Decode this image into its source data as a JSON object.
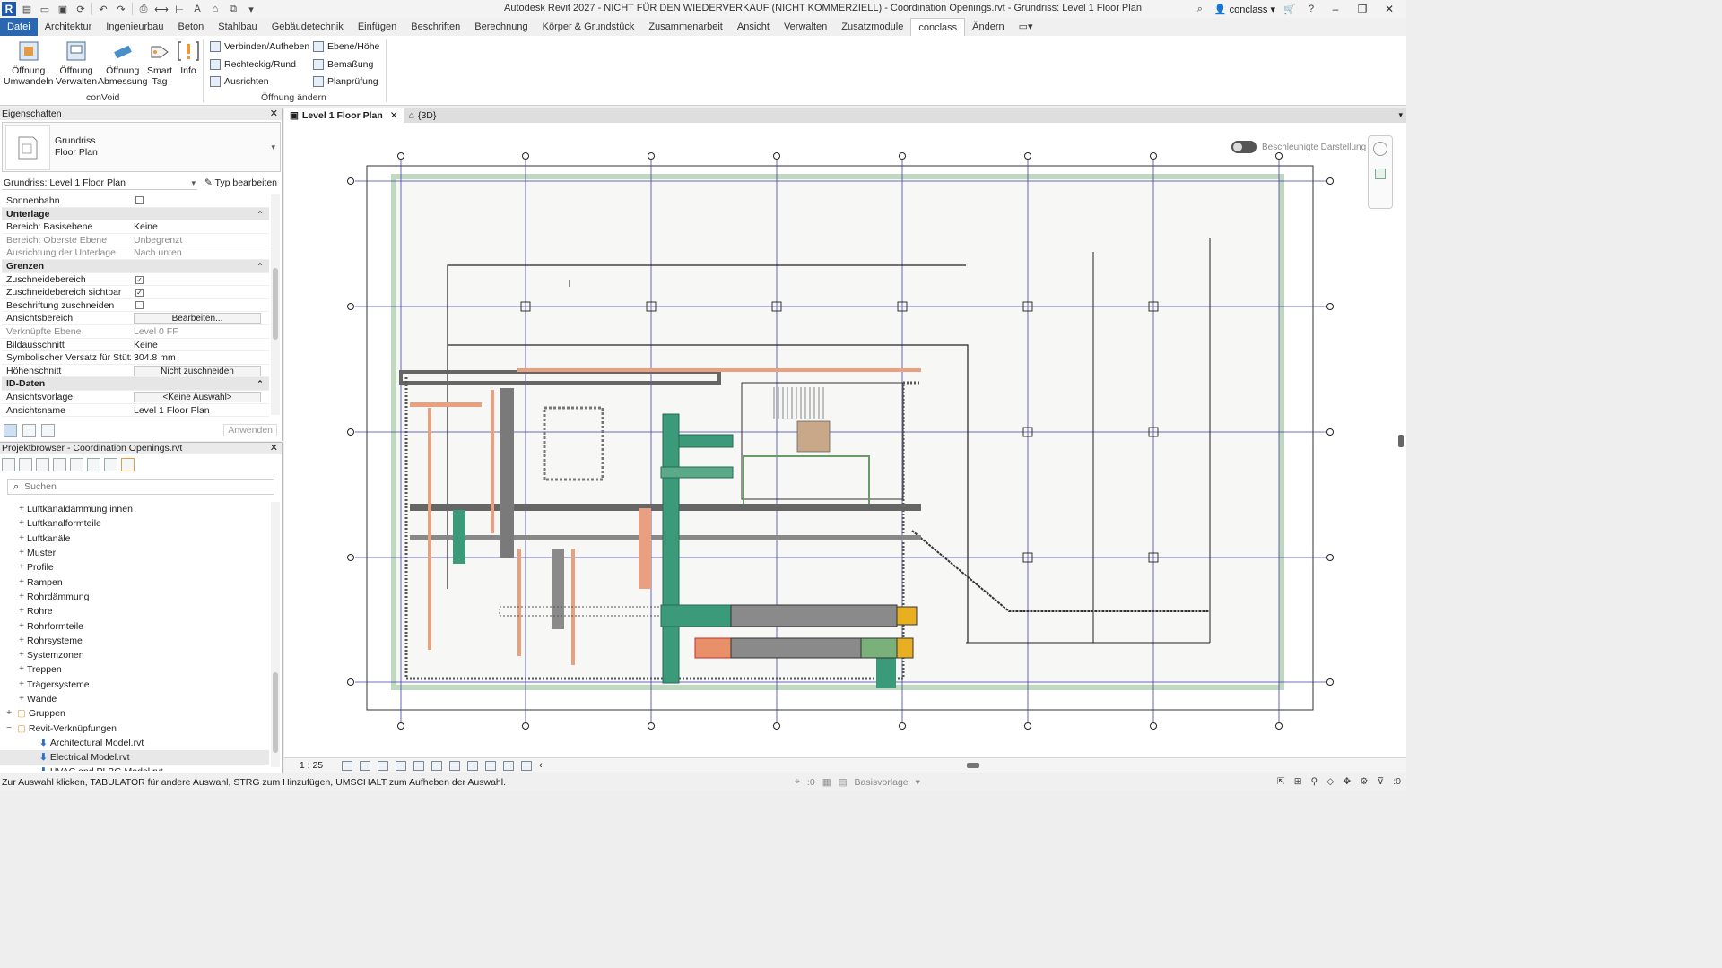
{
  "app": {
    "title": "Autodesk Revit 2027 - NICHT FÜR DEN WIEDERVERKAUF (NICHT KOMMERZIELL) - Coordination Openings.rvt - Grundriss: Level 1 Floor Plan",
    "user": "conclass"
  },
  "ribbon": {
    "tabs": [
      "Datei",
      "Architektur",
      "Ingenieurbau",
      "Beton",
      "Stahlbau",
      "Gebäudetechnik",
      "Einfügen",
      "Beschriften",
      "Berechnung",
      "Körper & Grundstück",
      "Zusammenarbeit",
      "Ansicht",
      "Verwalten",
      "Zusatzmodule",
      "conclass",
      "Ändern"
    ],
    "active_tab": "conclass",
    "convoid": {
      "label": "conVoid",
      "btn1": "Öffnung\nUmwandeln",
      "btn1a": "Öffnung",
      "btn1b": "Umwandeln",
      "btn2a": "Öffnung",
      "btn2b": "Verwalten",
      "btn3a": "Öffnung",
      "btn3b": "Abmessung",
      "btn4a": "Smart",
      "btn4b": "Tag",
      "btn5": "Info"
    },
    "oeffnung_aendern": {
      "label": "Öffnung ändern",
      "items": [
        "Verbinden/Aufheben",
        "Rechteckig/Rund",
        "Ausrichten",
        "Ebene/Höhe",
        "Bemaßung",
        "Planprüfung"
      ]
    }
  },
  "properties": {
    "title": "Eigenschaften",
    "type_line1": "Grundriss",
    "type_line2": "Floor Plan",
    "instance_selector": "Grundriss: Level 1 Floor Plan",
    "edit_type": "Typ bearbeiten",
    "apply": "Anwenden",
    "rows": [
      {
        "k": "Sonnenbahn",
        "v": "",
        "kind": "check",
        "checked": false
      },
      {
        "k": "Unterlage",
        "kind": "section"
      },
      {
        "k": "Bereich: Basisebene",
        "v": "Keine"
      },
      {
        "k": "Bereich: Oberste Ebene",
        "v": "Unbegrenzt",
        "ro": true
      },
      {
        "k": "Ausrichtung der Unterlage",
        "v": "Nach unten",
        "ro": true
      },
      {
        "k": "Grenzen",
        "kind": "section"
      },
      {
        "k": "Zuschneidebereich",
        "v": "",
        "kind": "check",
        "checked": true
      },
      {
        "k": "Zuschneidebereich sichtbar",
        "v": "",
        "kind": "check",
        "checked": true
      },
      {
        "k": "Beschriftung zuschneiden",
        "v": "",
        "kind": "check",
        "checked": false
      },
      {
        "k": "Ansichtsbereich",
        "v": "Bearbeiten...",
        "kind": "button"
      },
      {
        "k": "Verknüpfte Ebene",
        "v": "Level 0 FF",
        "ro": true
      },
      {
        "k": "Bildausschnitt",
        "v": "Keine"
      },
      {
        "k": "Symbolischer Versatz für Stütze",
        "v": "304.8 mm"
      },
      {
        "k": "Höhenschnitt",
        "v": "Nicht zuschneiden",
        "kind": "button"
      },
      {
        "k": "ID-Daten",
        "kind": "section"
      },
      {
        "k": "Ansichtsvorlage",
        "v": "<Keine Auswahl>",
        "kind": "button"
      },
      {
        "k": "Ansichtsname",
        "v": "Level 1 Floor Plan"
      }
    ]
  },
  "browser": {
    "title": "Projektbrowser - Coordination Openings.rvt",
    "search_placeholder": "Suchen",
    "items": [
      {
        "label": "Luftkanaldämmung innen",
        "indent": 1,
        "exp": "+"
      },
      {
        "label": "Luftkanalformteile",
        "indent": 1,
        "exp": "+"
      },
      {
        "label": "Luftkanäle",
        "indent": 1,
        "exp": "+"
      },
      {
        "label": "Muster",
        "indent": 1,
        "exp": "+"
      },
      {
        "label": "Profile",
        "indent": 1,
        "exp": "+"
      },
      {
        "label": "Rampen",
        "indent": 1,
        "exp": "+"
      },
      {
        "label": "Rohrdämmung",
        "indent": 1,
        "exp": "+"
      },
      {
        "label": "Rohre",
        "indent": 1,
        "exp": "+"
      },
      {
        "label": "Rohrformteile",
        "indent": 1,
        "exp": "+"
      },
      {
        "label": "Rohrsysteme",
        "indent": 1,
        "exp": "+"
      },
      {
        "label": "Systemzonen",
        "indent": 1,
        "exp": "+"
      },
      {
        "label": "Treppen",
        "indent": 1,
        "exp": "+"
      },
      {
        "label": "Trägersysteme",
        "indent": 1,
        "exp": "+"
      },
      {
        "label": "Wände",
        "indent": 1,
        "exp": "+"
      },
      {
        "label": "Gruppen",
        "indent": 0,
        "exp": "+"
      },
      {
        "label": "Revit-Verknüpfungen",
        "indent": 0,
        "exp": "−"
      },
      {
        "label": "Architectural Model.rvt",
        "indent": 2,
        "exp": "",
        "link": true
      },
      {
        "label": "Electrical Model.rvt",
        "indent": 2,
        "exp": "",
        "link": true,
        "selected": true
      },
      {
        "label": "HVAC and PLBG Model.rvt",
        "indent": 2,
        "exp": "",
        "link": true
      }
    ]
  },
  "view_tabs": [
    {
      "label": "Level 1 Floor Plan",
      "active": true
    },
    {
      "label": "{3D}",
      "active": false
    }
  ],
  "canvas": {
    "accel_label": "Beschleunigte Darstellung"
  },
  "viewbar": {
    "scale": "1 : 25"
  },
  "status": {
    "text": "Zur Auswahl klicken, TABULATOR für andere Auswahl, STRG zum Hinzufügen, UMSCHALT zum Aufheben der Auswahl.",
    "workset_count": ":0",
    "template": "Basisvorlage",
    "filter_count": ":0"
  },
  "colors": {
    "grid": "#4040a8",
    "duct_green": "#3a9a7a",
    "pipe_orange": "#e8a080",
    "duct_gray": "#8a8a8a",
    "file_tab": "#2b66b0"
  }
}
